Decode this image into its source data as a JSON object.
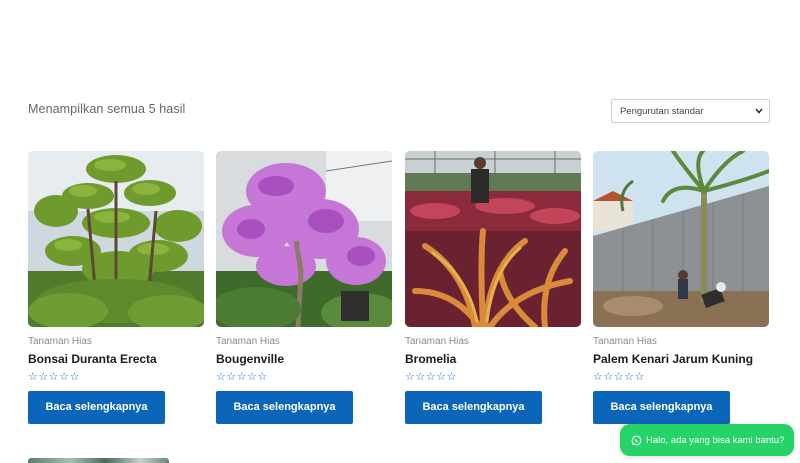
{
  "shop": {
    "result_count": "Menampilkan semua 5 hasil",
    "ordering_selected": "Pengurutan standar"
  },
  "products": [
    {
      "category": "Tanaman Hias",
      "title": "Bonsai Duranta Erecta",
      "rating": "☆☆☆☆☆",
      "button": "Baca selengkapnya",
      "image": "bonsai-duranta-photo"
    },
    {
      "category": "Tanaman Hias",
      "title": "Bougenville",
      "rating": "☆☆☆☆☆",
      "button": "Baca selengkapnya",
      "image": "bougainvillea-photo"
    },
    {
      "category": "Tanaman Hias",
      "title": "Bromelia",
      "rating": "☆☆☆☆☆",
      "button": "Baca selengkapnya",
      "image": "bromelia-nursery-photo"
    },
    {
      "category": "Tanaman Hias",
      "title": "Palem Kenari Jarum Kuning",
      "rating": "☆☆☆☆☆",
      "button": "Baca selengkapnya",
      "image": "palm-planting-photo"
    }
  ],
  "chat": {
    "label": "Halo, ada yang bisa kami bantu?",
    "icon": "whatsapp-icon"
  },
  "colors": {
    "button_bg": "#0b65b8",
    "chat_bg": "#25d366",
    "star": "#2a6cc4"
  }
}
